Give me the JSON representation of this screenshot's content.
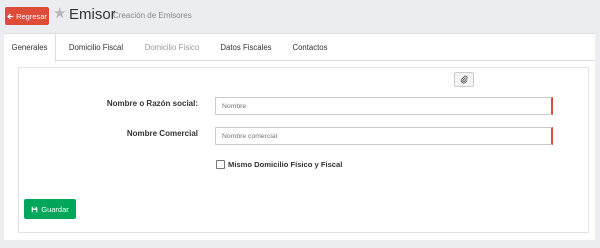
{
  "header": {
    "back_label": "Regresar",
    "title": "Emisor",
    "subtitle": "Creación de Emisores"
  },
  "tabs": [
    {
      "label": "Generales",
      "state": "active"
    },
    {
      "label": "Domicilio Fiscal",
      "state": "normal"
    },
    {
      "label": "Domicilio Físico",
      "state": "disabled"
    },
    {
      "label": "Datos Fiscales",
      "state": "normal"
    },
    {
      "label": "Contactos",
      "state": "normal"
    }
  ],
  "form": {
    "name_label": "Nombre o Razón social:",
    "name_placeholder": "Nombre",
    "commercial_label": "Nombre Comercial",
    "commercial_placeholder": "Nombre comercial",
    "same_address_label": "Mismo Domicilio Físico y Fiscal",
    "same_address_checked": false
  },
  "actions": {
    "save_label": "Guardar"
  },
  "colors": {
    "back_button": "#dd4b39",
    "save_button": "#00a65a",
    "required_marker": "#dd4b39"
  },
  "icons": {
    "back": "arrow-left-icon",
    "title": "star-icon",
    "attach": "paperclip-icon",
    "save": "floppy-disk-icon"
  }
}
